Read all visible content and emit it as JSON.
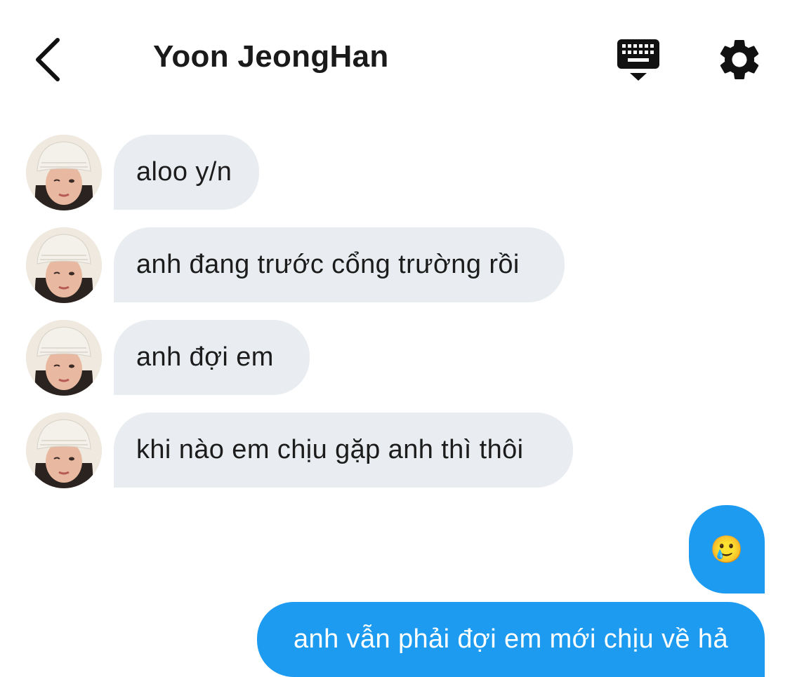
{
  "header": {
    "title": "Yoon JeongHan",
    "back_icon": "chevron-left-icon",
    "keyboard_icon": "keyboard-hide-icon",
    "settings_icon": "gear-icon"
  },
  "colors": {
    "incoming_bubble": "#e9edf1",
    "outgoing_bubble": "#1d9bf0",
    "outgoing_text": "#ffffff"
  },
  "messages": [
    {
      "direction": "incoming",
      "text": "aloo y/n"
    },
    {
      "direction": "incoming",
      "text": "anh đang trước cổng trường rồi"
    },
    {
      "direction": "incoming",
      "text": "anh đợi em"
    },
    {
      "direction": "incoming",
      "text": "khi nào em chịu gặp anh thì thôi"
    },
    {
      "direction": "outgoing",
      "text": "🥲"
    },
    {
      "direction": "outgoing",
      "text": "anh vẫn phải đợi em mới chịu về hả"
    }
  ]
}
